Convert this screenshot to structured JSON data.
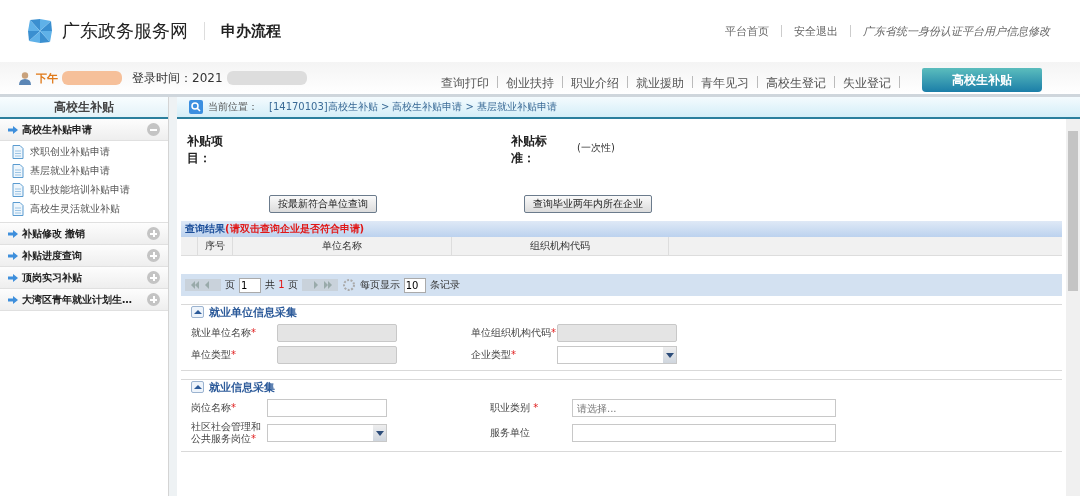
{
  "header": {
    "site_title": "广东政务服务网",
    "section_title": "申办流程",
    "links": [
      {
        "label": "平台首页",
        "kind": "plain"
      },
      {
        "label": "安全退出",
        "kind": "plain"
      },
      {
        "label": "广东省统一身份认证平台用户信息修改",
        "kind": "italic"
      }
    ]
  },
  "user_bar": {
    "greeting": "下午",
    "login_time": "登录时间：2021"
  },
  "tabs": [
    {
      "label": "查询打印",
      "selected": false
    },
    {
      "label": "创业扶持",
      "selected": false
    },
    {
      "label": "职业介绍",
      "selected": false
    },
    {
      "label": "就业援助",
      "selected": false
    },
    {
      "label": "青年见习",
      "selected": false
    },
    {
      "label": "高校生登记",
      "selected": false
    },
    {
      "label": "失业登记",
      "selected": false
    },
    {
      "label": "高校生补贴",
      "selected": true
    }
  ],
  "sidebar": {
    "title": "高校生补贴",
    "groups": [
      {
        "label": "高校生补贴申请",
        "expanded": true,
        "children": [
          {
            "label": "求职创业补贴申请"
          },
          {
            "label": "基层就业补贴申请"
          },
          {
            "label": "职业技能培训补贴申请"
          },
          {
            "label": "高校生灵活就业补贴"
          }
        ]
      },
      {
        "label": "补贴修改 撤销",
        "expanded": false
      },
      {
        "label": "补贴进度查询",
        "expanded": false
      },
      {
        "label": "顶岗实习补贴",
        "expanded": false
      },
      {
        "label": "大湾区青年就业计划生…",
        "expanded": false
      }
    ]
  },
  "breadcrumb": {
    "label": "当前位置：",
    "path": "[14170103]高校生补贴 > 高校生补贴申请 > 基层就业补贴申请"
  },
  "subsidy": {
    "item_label": "补贴项目：",
    "standard_label": "补贴标准：",
    "standard_value": "(一次性)"
  },
  "query_buttons": [
    "按最新符合单位查询",
    "查询毕业两年内所在企业"
  ],
  "results": {
    "title": "查询结果",
    "note": "(请双击查询企业是否符合申请)",
    "columns": [
      "序号",
      "单位名称",
      "组织机构代码"
    ]
  },
  "pager": {
    "page_label": "页",
    "page": "1",
    "total_prefix": "共",
    "total": "1",
    "total_suffix": "页",
    "per_page_label": "每页显示",
    "per_page": "10",
    "per_page_suffix": "条记录"
  },
  "sections": [
    {
      "title": "就业单位信息采集",
      "expanded": true,
      "fields": [
        {
          "label": "就业单位名称",
          "required_mark": "*",
          "kind": "readonly"
        },
        {
          "label": "单位组织机构代码",
          "required_mark": "*",
          "kind": "readonly"
        },
        {
          "label": "单位类型",
          "required_mark": "*",
          "kind": "readonly"
        },
        {
          "label": "企业类型",
          "required_mark": "*",
          "kind": "select"
        }
      ]
    },
    {
      "title": "就业信息采集",
      "expanded": true,
      "fields": [
        {
          "label": "岗位名称",
          "required_mark": "*",
          "kind": "text"
        },
        {
          "label": "职业类别",
          "required_mark": " *",
          "kind": "picker",
          "placeholder": "请选择..."
        },
        {
          "label": "社区社会管理和公共服务岗位",
          "required_mark": "*",
          "kind": "select"
        },
        {
          "label": "服务单位",
          "kind": "text"
        }
      ]
    }
  ]
}
